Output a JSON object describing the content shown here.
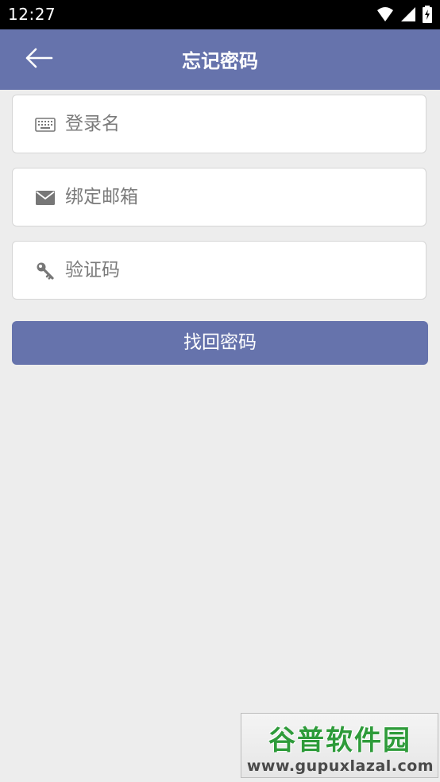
{
  "status_bar": {
    "time": "12:27",
    "icons": [
      "wifi-icon",
      "signal-icon",
      "battery-icon"
    ]
  },
  "header": {
    "title": "忘记密码",
    "back_icon": "back-arrow-icon"
  },
  "form": {
    "username": {
      "placeholder": "登录名",
      "value": "",
      "icon": "keyboard-icon"
    },
    "email": {
      "placeholder": "绑定邮箱",
      "value": "",
      "icon": "envelope-icon"
    },
    "code": {
      "placeholder": "验证码",
      "value": "",
      "icon": "key-icon"
    },
    "submit_label": "找回密码"
  },
  "watermark": {
    "title": "谷普软件园",
    "url": "www.gupuxlazal.com"
  },
  "colors": {
    "accent": "#6673ac",
    "background": "#ededed",
    "status_bar": "#000000"
  }
}
